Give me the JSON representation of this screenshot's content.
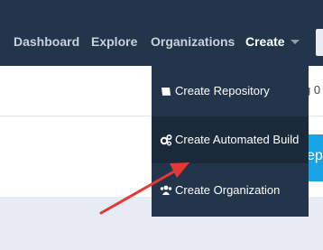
{
  "nav": {
    "dashboard": "Dashboard",
    "explore": "Explore",
    "organizations": "Organizations",
    "create": "Create"
  },
  "dropdown": {
    "items": [
      {
        "label": "Create Repository",
        "icon": "book-icon"
      },
      {
        "label": "Create Automated Build",
        "icon": "cogs-icon"
      },
      {
        "label": "Create Organization",
        "icon": "users-icon"
      }
    ]
  },
  "page": {
    "partial_text": "g 0",
    "partial_button": "ep"
  },
  "colors": {
    "topbar": "#22354a",
    "menu_bg": "#22354a",
    "menu_hover": "#1b2a3b",
    "accent_blue": "#1aa3e6",
    "annotation_arrow": "#e53935"
  }
}
